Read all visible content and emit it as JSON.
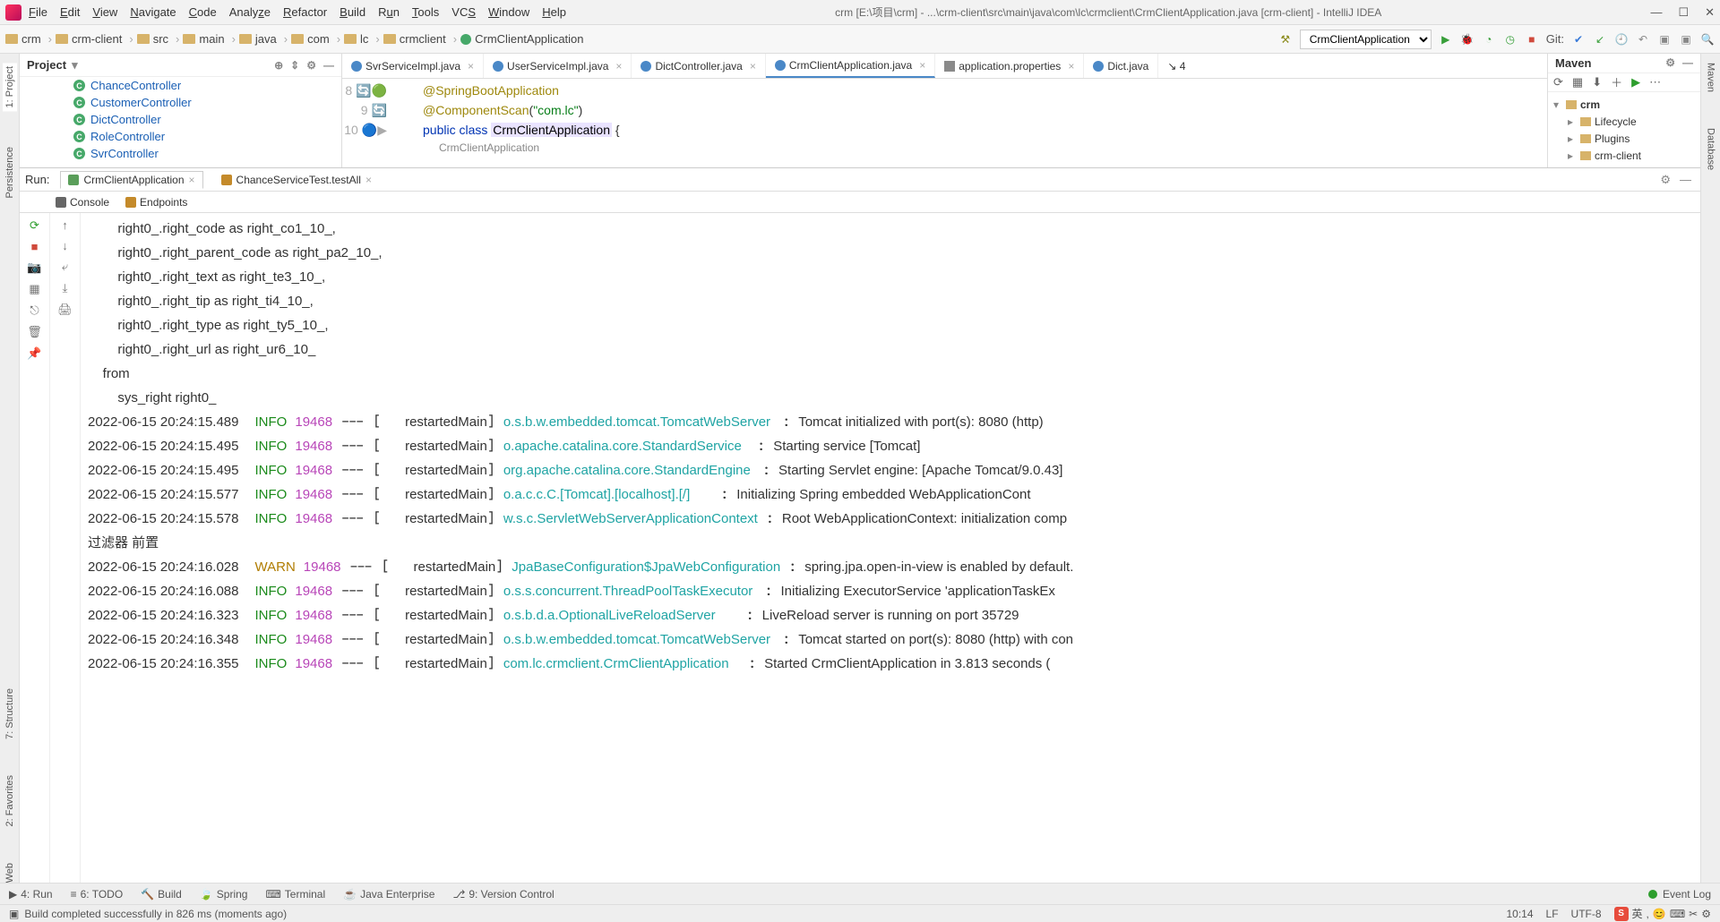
{
  "window": {
    "title": "crm [E:\\项目\\crm] - ...\\crm-client\\src\\main\\java\\com\\lc\\crmclient\\CrmClientApplication.java [crm-client] - IntelliJ IDEA"
  },
  "menu": [
    "File",
    "Edit",
    "View",
    "Navigate",
    "Code",
    "Analyze",
    "Refactor",
    "Build",
    "Run",
    "Tools",
    "VCS",
    "Window",
    "Help"
  ],
  "breadcrumbs": [
    "crm",
    "crm-client",
    "src",
    "main",
    "java",
    "com",
    "lc",
    "crmclient",
    "CrmClientApplication"
  ],
  "runConfig": {
    "selected": "CrmClientApplication",
    "gitLabel": "Git:"
  },
  "projectPanel": {
    "title": "Project",
    "items": [
      {
        "name": "ChanceController"
      },
      {
        "name": "CustomerController"
      },
      {
        "name": "DictController",
        "sel": true
      },
      {
        "name": "RoleController"
      },
      {
        "name": "SvrController"
      }
    ]
  },
  "editorTabs": [
    {
      "label": "SvrServiceImpl.java"
    },
    {
      "label": "UserServiceImpl.java"
    },
    {
      "label": "DictController.java"
    },
    {
      "label": "CrmClientApplication.java",
      "active": true
    },
    {
      "label": "application.properties",
      "prop": true
    },
    {
      "label": "Dict.java",
      "trunc": true
    }
  ],
  "editor": {
    "anchor": "↘ 4",
    "lines": {
      "n8": "8",
      "n9": "9",
      "n10": "10",
      "l8_anno": "@SpringBootApplication",
      "l9_anno": "@ComponentScan",
      "l9_paren_open": "(",
      "l9_str": "\"com.lc\"",
      "l9_paren_close": ")",
      "l10_kw": "public class ",
      "l10_cls": "CrmClientApplication",
      "l10_brace": " {"
    },
    "crumbPath": "CrmClientApplication"
  },
  "maven": {
    "title": "Maven",
    "root": "crm",
    "items": [
      "Lifecycle",
      "Plugins",
      "crm-client"
    ]
  },
  "leftTabs": [
    "1: Project",
    "Persistence",
    "7: Structure",
    "2: Favorites",
    "Web"
  ],
  "rightTabs": [
    "Maven",
    "Database"
  ],
  "run": {
    "label": "Run:",
    "tabs": [
      {
        "label": "CrmClientApplication",
        "active": true
      },
      {
        "label": "ChanceServiceTest.testAll"
      }
    ],
    "subTabs": [
      "Console",
      "Endpoints"
    ],
    "consolePre": [
      "        right0_.right_code as right_co1_10_,",
      "        right0_.right_parent_code as right_pa2_10_,",
      "        right0_.right_text as right_te3_10_,",
      "        right0_.right_tip as right_ti4_10_,",
      "        right0_.right_type as right_ty5_10_,",
      "        right0_.right_url as right_ur6_10_ ",
      "    from",
      "        sys_right right0_"
    ],
    "logRows": [
      {
        "ts": "2022-06-15 20:24:15.489",
        "lvl": "INFO",
        "pid": "19468",
        "thr": "restartedMain",
        "log": "o.s.b.w.embedded.tomcat.TomcatWebServer",
        "msg": "Tomcat initialized with port(s): 8080 (http)"
      },
      {
        "ts": "2022-06-15 20:24:15.495",
        "lvl": "INFO",
        "pid": "19468",
        "thr": "restartedMain",
        "log": "o.apache.catalina.core.StandardService",
        "msg": "Starting service [Tomcat]"
      },
      {
        "ts": "2022-06-15 20:24:15.495",
        "lvl": "INFO",
        "pid": "19468",
        "thr": "restartedMain",
        "log": "org.apache.catalina.core.StandardEngine",
        "msg": "Starting Servlet engine: [Apache Tomcat/9.0.43]"
      },
      {
        "ts": "2022-06-15 20:24:15.577",
        "lvl": "INFO",
        "pid": "19468",
        "thr": "restartedMain",
        "log": "o.a.c.c.C.[Tomcat].[localhost].[/]",
        "msg": "Initializing Spring embedded WebApplicationCont"
      },
      {
        "ts": "2022-06-15 20:24:15.578",
        "lvl": "INFO",
        "pid": "19468",
        "thr": "restartedMain",
        "log": "w.s.c.ServletWebServerApplicationContext",
        "msg": "Root WebApplicationContext: initialization comp"
      }
    ],
    "midLine": "过滤器 前置",
    "logRows2": [
      {
        "ts": "2022-06-15 20:24:16.028",
        "lvl": "WARN",
        "pid": "19468",
        "thr": "restartedMain",
        "log": "JpaBaseConfiguration$JpaWebConfiguration",
        "msg": "spring.jpa.open-in-view is enabled by default."
      },
      {
        "ts": "2022-06-15 20:24:16.088",
        "lvl": "INFO",
        "pid": "19468",
        "thr": "restartedMain",
        "log": "o.s.s.concurrent.ThreadPoolTaskExecutor",
        "msg": "Initializing ExecutorService 'applicationTaskEx"
      },
      {
        "ts": "2022-06-15 20:24:16.323",
        "lvl": "INFO",
        "pid": "19468",
        "thr": "restartedMain",
        "log": "o.s.b.d.a.OptionalLiveReloadServer",
        "msg": "LiveReload server is running on port 35729"
      },
      {
        "ts": "2022-06-15 20:24:16.348",
        "lvl": "INFO",
        "pid": "19468",
        "thr": "restartedMain",
        "log": "o.s.b.w.embedded.tomcat.TomcatWebServer",
        "msg": "Tomcat started on port(s): 8080 (http) with con"
      },
      {
        "ts": "2022-06-15 20:24:16.355",
        "lvl": "INFO",
        "pid": "19468",
        "thr": "restartedMain",
        "log": "com.lc.crmclient.CrmClientApplication",
        "msg": "Started CrmClientApplication in 3.813 seconds ("
      }
    ]
  },
  "bottomTabs": [
    "4: Run",
    "6: TODO",
    "Build",
    "Spring",
    "Terminal",
    "Java Enterprise",
    "9: Version Control"
  ],
  "bottomRight": "Event Log",
  "status": {
    "msg": "Build completed successfully in 826 ms (moments ago)",
    "pos": "10:14",
    "sep": "LF",
    "enc": "UTF-8"
  },
  "ime": {
    "s": "S",
    "lang": "英",
    "punct": ",",
    "emo": "😊",
    "kbd": "⌨",
    "cb": "✂",
    "gear": "⚙"
  }
}
